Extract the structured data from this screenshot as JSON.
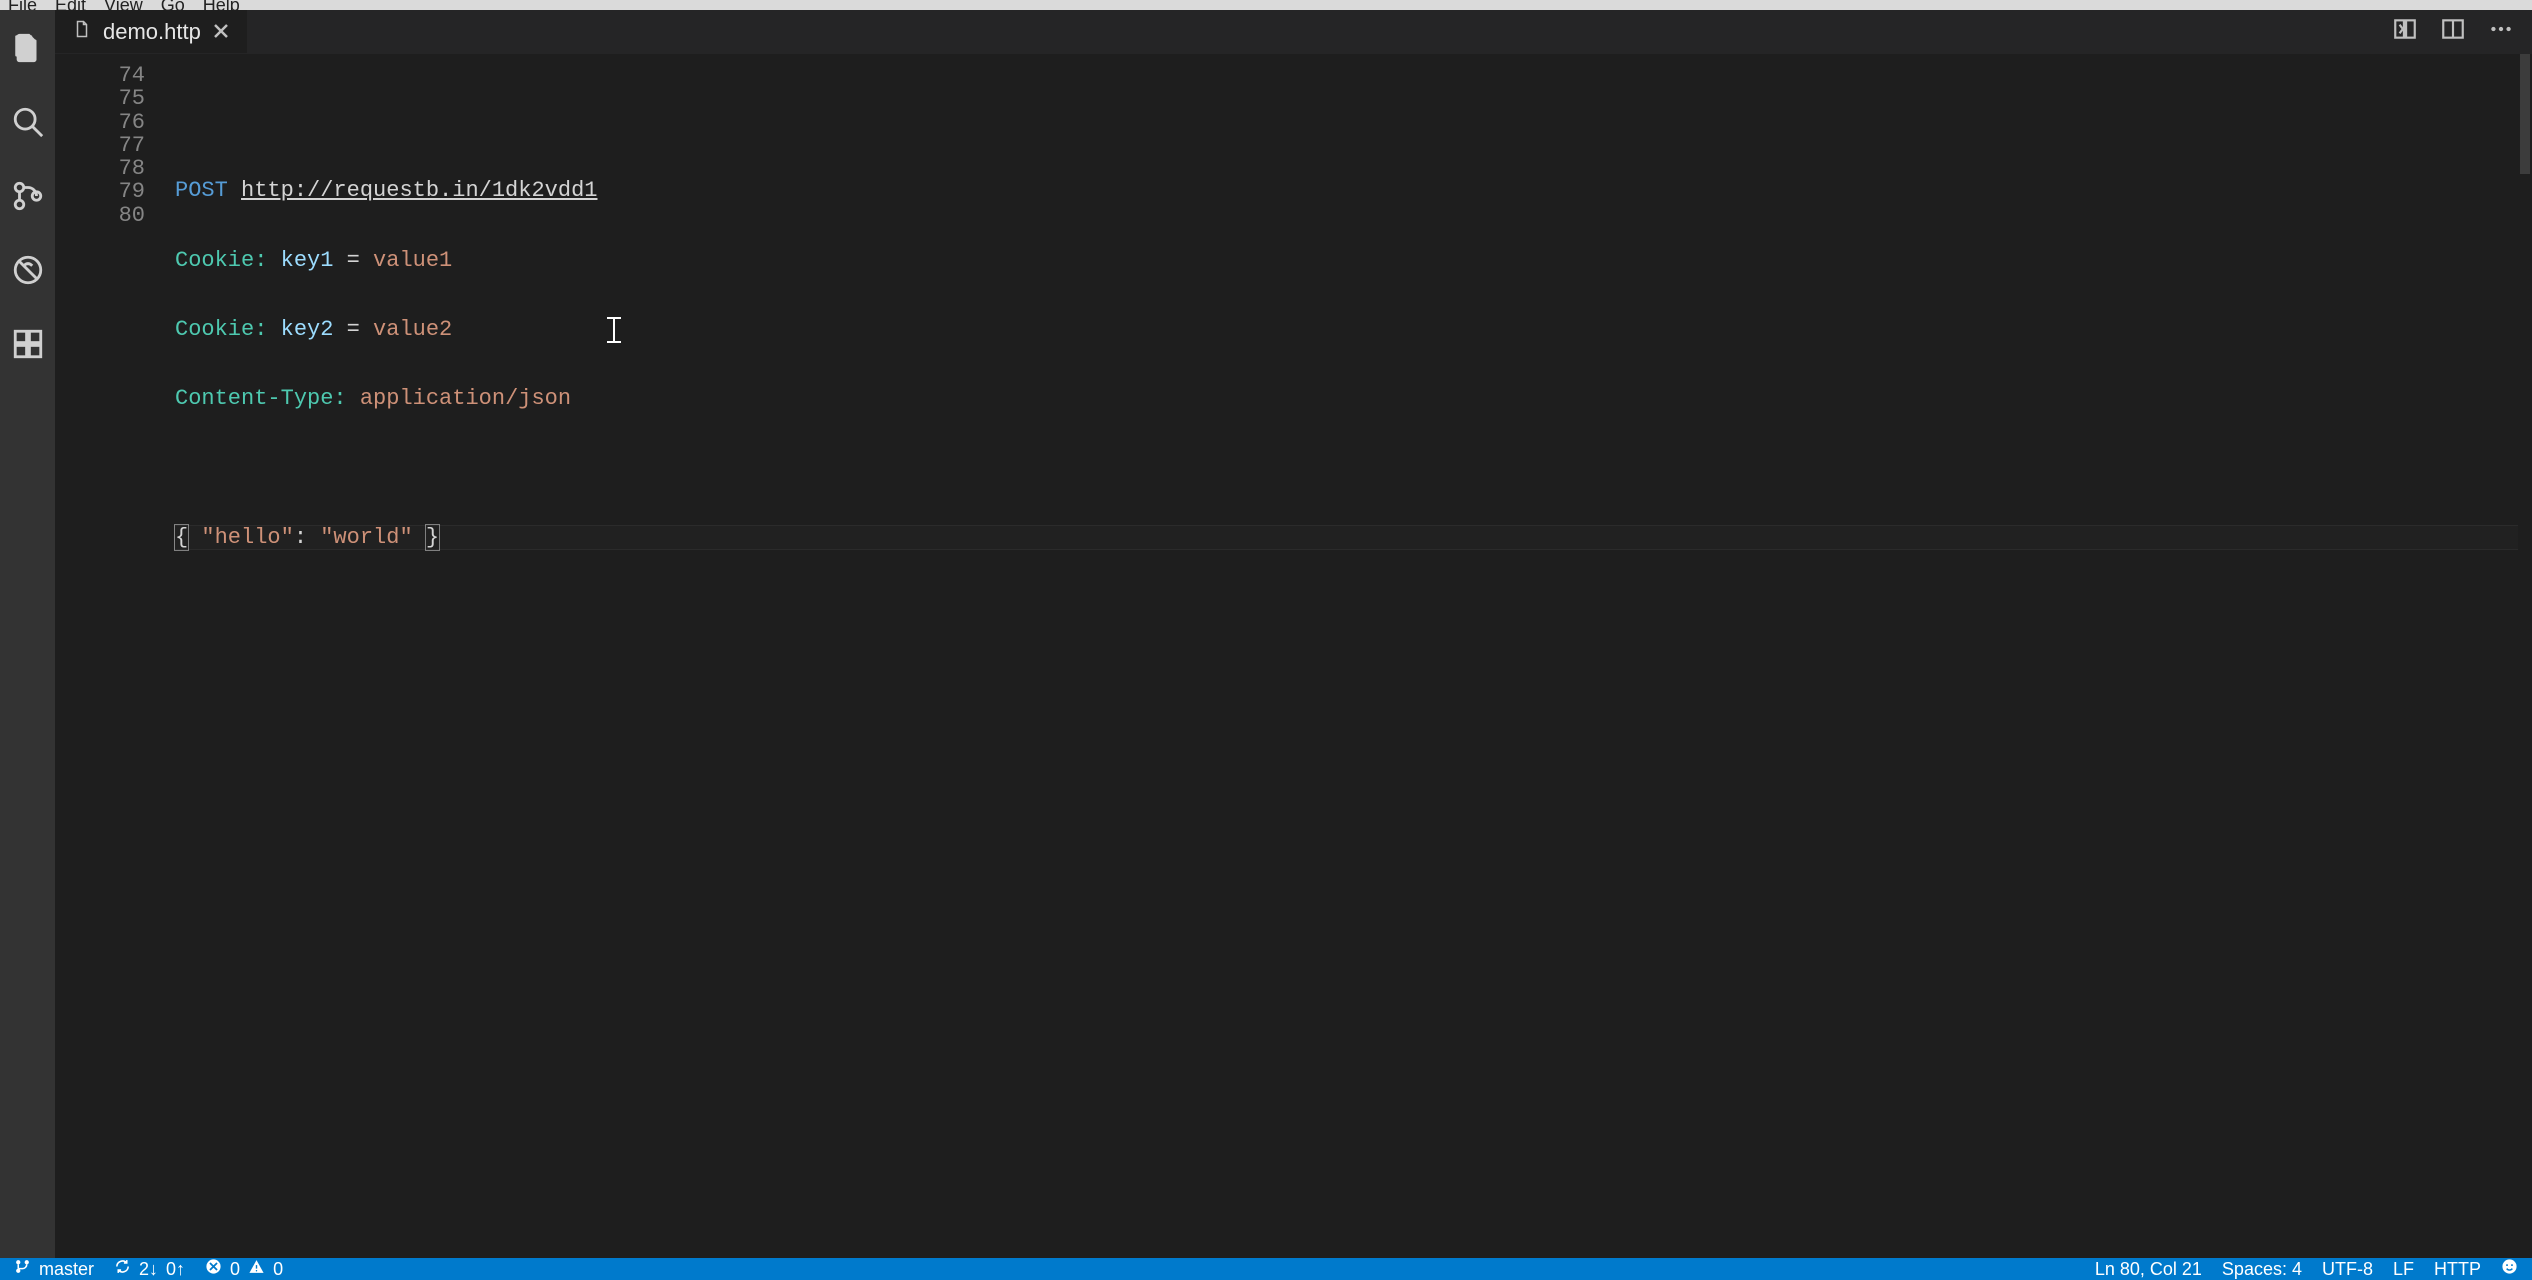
{
  "menubar": {
    "items": [
      "File",
      "Edit",
      "View",
      "Go",
      "Help"
    ]
  },
  "tab": {
    "filename": "demo.http"
  },
  "editor": {
    "line_numbers": [
      "74",
      "75",
      "76",
      "77",
      "78",
      "79",
      "80"
    ],
    "l75": {
      "method": "POST",
      "url": "http://requestb.in/1dk2vdd1"
    },
    "l76": {
      "header": "Cookie:",
      "key": "key1",
      "op": "=",
      "val": "value1"
    },
    "l77": {
      "header": "Cookie:",
      "key": "key2",
      "op": "=",
      "val": "value2"
    },
    "l78": {
      "header": "Content-Type:",
      "ctype": "application/json"
    },
    "l80": {
      "open": "{",
      "k": "\"hello\"",
      "colon": ":",
      "v": "\"world\"",
      "close": "}"
    }
  },
  "statusbar": {
    "branch": "master",
    "sync_down": "2↓",
    "sync_up": "0↑",
    "errors": "0",
    "warnings": "0",
    "cursor": "Ln 80, Col 21",
    "spaces": "Spaces: 4",
    "encoding": "UTF-8",
    "eol": "LF",
    "language": "HTTP"
  }
}
